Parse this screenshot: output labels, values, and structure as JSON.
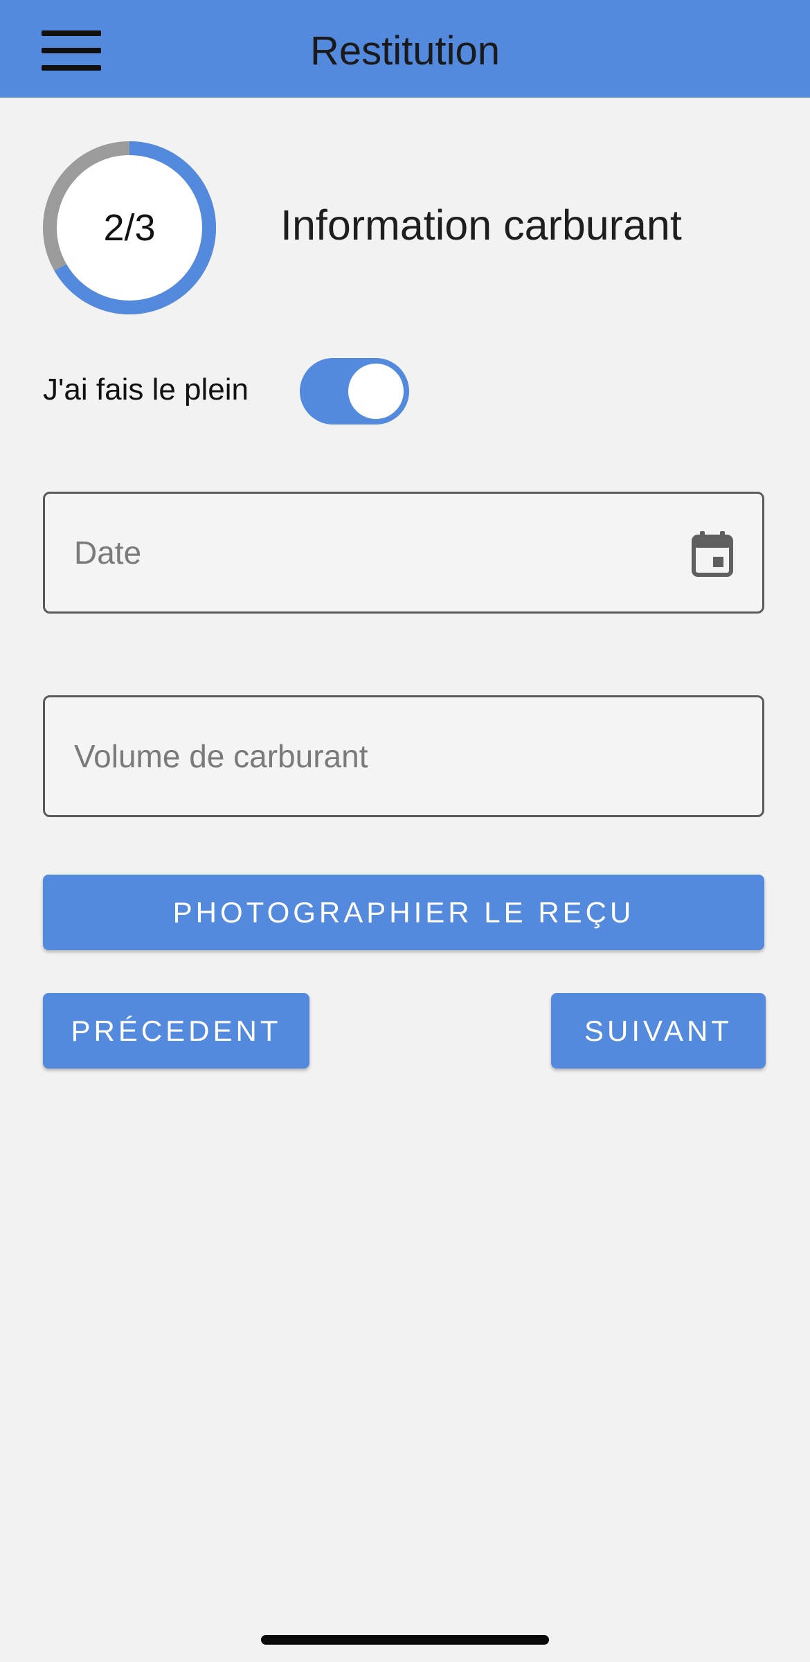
{
  "header": {
    "title": "Restitution",
    "menu_icon": "hamburger-menu-icon"
  },
  "stepper": {
    "current": 2,
    "total": 3,
    "label": "2/3",
    "title": "Information carburant"
  },
  "fuel_toggle": {
    "label": "J'ai fais le plein",
    "checked": true
  },
  "form": {
    "date_placeholder": "Date",
    "date_value": "",
    "calendar_icon": "calendar-icon",
    "volume_placeholder": "Volume de carburant",
    "volume_value": ""
  },
  "buttons": {
    "photo_label": "PHOTOGRAPHIER LE REÇU",
    "previous_label": "PRÉCEDENT",
    "next_label": "SUIVANT"
  },
  "colors": {
    "primary": "#548ade",
    "background": "#f2f2f2",
    "ring_track": "#9b9b9b"
  }
}
